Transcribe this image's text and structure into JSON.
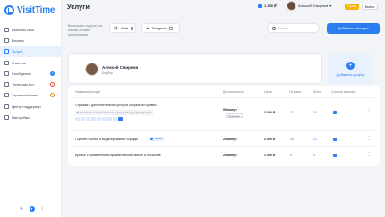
{
  "app": {
    "logo_text": "VisitTime"
  },
  "sidebar": {
    "items": [
      {
        "label": "Рабочий стол",
        "icon": "dashboard-icon",
        "badge": ""
      },
      {
        "label": "Визиты",
        "icon": "calendar-icon",
        "badge": ""
      },
      {
        "label": "Услуги",
        "icon": "scissors-icon",
        "badge": ""
      },
      {
        "label": "Клиенты",
        "icon": "users-icon",
        "badge": ""
      },
      {
        "label": "Сообщения",
        "icon": "message-icon",
        "badge": "2"
      },
      {
        "label": "Телеграм-бот",
        "icon": "telegram-icon",
        "badge": "!"
      },
      {
        "label": "Тарифный план",
        "icon": "tariff-icon",
        "badge": "!"
      },
      {
        "label": "Центр поддержки",
        "icon": "support-icon",
        "badge": ""
      },
      {
        "label": "Настройки",
        "icon": "settings-icon",
        "badge": ""
      }
    ],
    "active_index": 2
  },
  "topbar": {
    "title": "Услуги",
    "balance": "1 250 ₽",
    "user_name": "Алексей Смирнов",
    "tariff_label": "Тариф",
    "exit_label": "Выйти"
  },
  "share": {
    "label": "Вы можете поделиться вашим онлайн расписанием",
    "web_label": "Web",
    "telegram_label": "Telegram"
  },
  "search": {
    "placeholder": "Поиск"
  },
  "add_master_label": "Добавить мастера",
  "master": {
    "name": "Алексей Смирнов",
    "role": "Барбер"
  },
  "add_user_label": "Добавить услугу",
  "table": {
    "headers": [
      "Название услуги",
      "Длительность",
      "Цена",
      "Отзывы",
      "Фото",
      "Ссылка в запись"
    ],
    "rows": [
      {
        "name": "Стрижка с дополнительной услугой коррекции бровей",
        "note": "В сочетании с окрашиванием и укладкой подходит стрижка",
        "duration": "90 минут",
        "duration_tag": "Перерыв",
        "price": "3 000 ₽",
        "reviews": "12",
        "photos": "24"
      },
      {
        "name": "Горячее бритье и моделирование бороды",
        "badge": "Акция",
        "duration": "20 минут",
        "price": "2 500 ₽",
        "reviews": "19",
        "photos": "21"
      },
      {
        "name": "Бритье с применением ароматических масел и лосьонов",
        "duration": "25 минут",
        "price": "1 500 ₽",
        "reviews": "0",
        "photos": "0"
      }
    ]
  },
  "colors": {
    "accent": "#2a7ef0",
    "tariff": "#f5b300",
    "active_bg": "#e8f1fe"
  }
}
